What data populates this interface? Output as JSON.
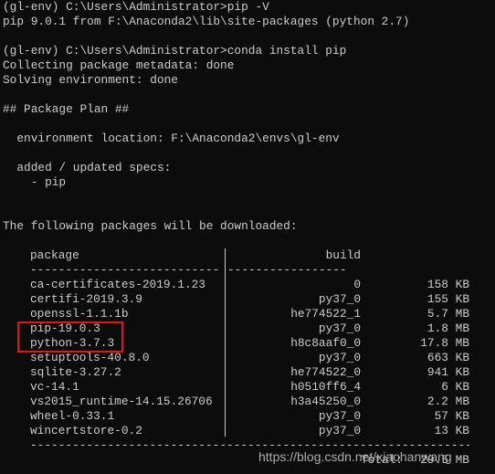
{
  "terminal": {
    "lines": [
      "(gl-env) C:\\Users\\Administrator>pip -V",
      "pip 9.0.1 from F:\\Anaconda2\\lib\\site-packages (python 2.7)",
      "",
      "(gl-env) C:\\Users\\Administrator>conda install pip",
      "Collecting package metadata: done",
      "Solving environment: done",
      "",
      "## Package Plan ##",
      "",
      "  environment location: F:\\Anaconda2\\envs\\gl-env",
      "",
      "  added / updated specs:",
      "    - pip",
      "",
      "",
      "The following packages will be downloaded:"
    ],
    "table": {
      "header_package": "package",
      "header_build": "build",
      "rows": [
        {
          "package": "ca-certificates-2019.1.23",
          "build": "0",
          "size": "158 KB"
        },
        {
          "package": "certifi-2019.3.9",
          "build": "py37_0",
          "size": "155 KB"
        },
        {
          "package": "openssl-1.1.1b",
          "build": "he774522_1",
          "size": "5.7 MB"
        },
        {
          "package": "pip-19.0.3",
          "build": "py37_0",
          "size": "1.8 MB"
        },
        {
          "package": "python-3.7.3",
          "build": "h8c8aaf0_0",
          "size": "17.8 MB"
        },
        {
          "package": "setuptools-40.8.0",
          "build": "py37_0",
          "size": "663 KB"
        },
        {
          "package": "sqlite-3.27.2",
          "build": "he774522_0",
          "size": "941 KB"
        },
        {
          "package": "vc-14.1",
          "build": "h0510ff6_4",
          "size": "6 KB"
        },
        {
          "package": "vs2015_runtime-14.15.26706",
          "build": "h3a45250_0",
          "size": "2.2 MB"
        },
        {
          "package": "wheel-0.33.1",
          "build": "py37_0",
          "size": "57 KB"
        },
        {
          "package": "wincertstore-0.2",
          "build": "py37_0",
          "size": "13 KB"
        }
      ],
      "total_label": "Total:",
      "total_value": "29.5 MB"
    },
    "highlight_color": "#e0161b"
  },
  "watermark": "https://blog.csdn.net/xiaohanwang"
}
